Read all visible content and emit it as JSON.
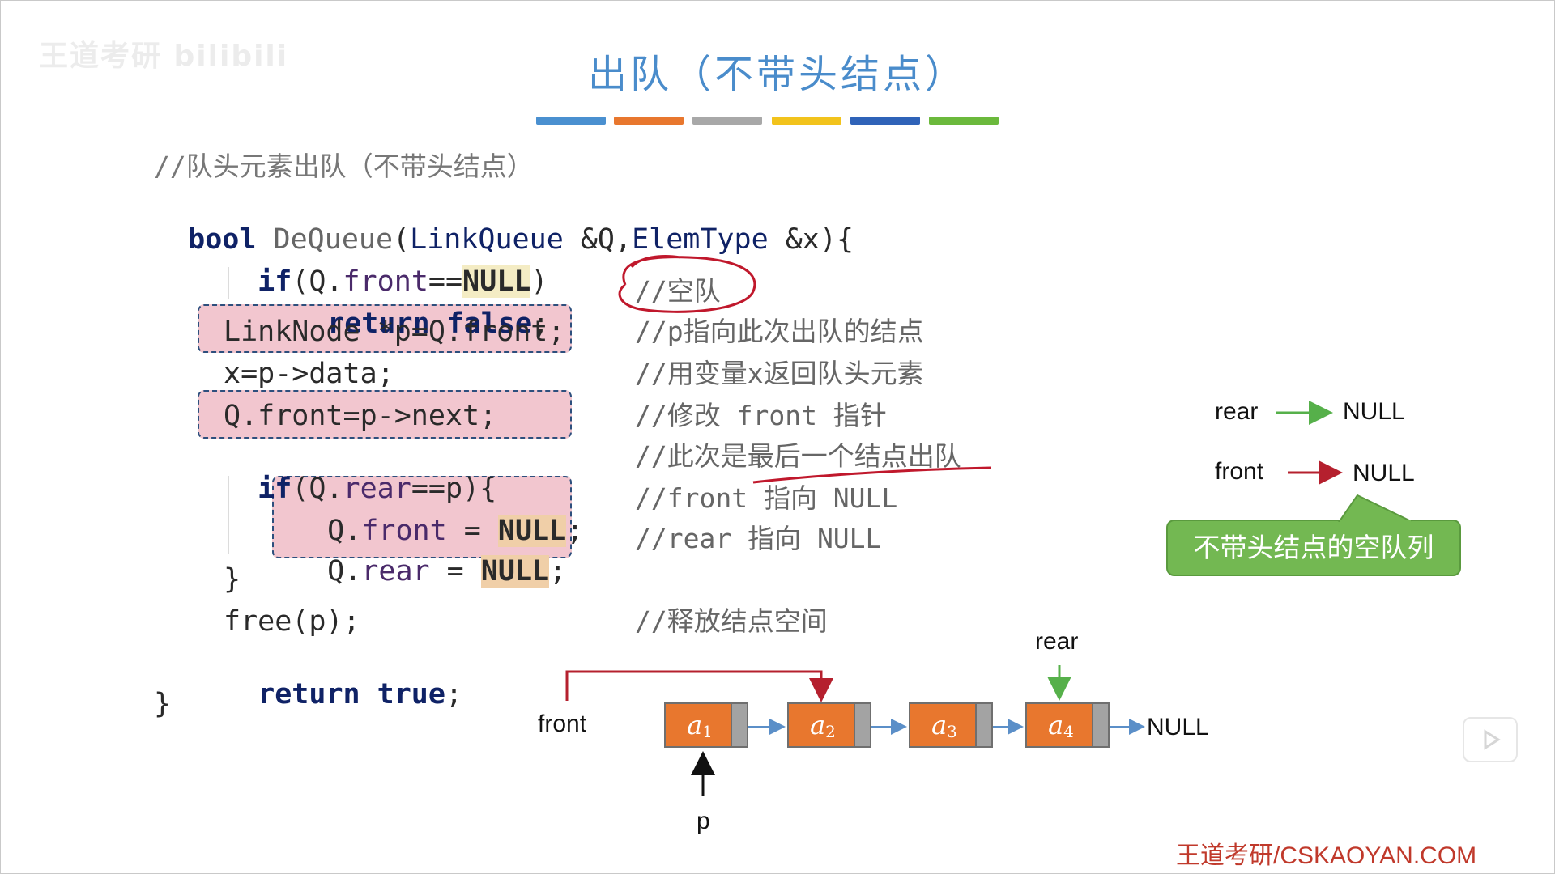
{
  "slide": {
    "watermark": "王道考研 bilibili",
    "title": "出队（不带头结点）",
    "color_bar": [
      "#4a90d0",
      "#e8772e",
      "#a8a8a8",
      "#f2c31c",
      "#2f63b8",
      "#6bb93c"
    ],
    "footer": "王道考研/CSKAOYAN.COM"
  },
  "code": {
    "header_comment": "//队头元素出队（不带头结点）",
    "l1": {
      "kw": "bool",
      "fn": "DeQueue",
      "p1": "(",
      "t1": "LinkQueue",
      "p2": " &Q,",
      "t2": "ElemType",
      "p3": " &x){"
    },
    "l2": {
      "kw": "if",
      "a": "(Q.",
      "m": "front",
      "b": "==",
      "n": "NULL",
      "c": ")"
    },
    "l3": {
      "kw": "return false",
      "c": ";"
    },
    "l4": "LinkNode *p=Q.front;",
    "l5": "x=p->data;",
    "l6": "Q.front=p->next;",
    "l7": {
      "kw": "if",
      "a": "(Q.",
      "m": "rear",
      "b": "==p){"
    },
    "l8": {
      "a": "Q.",
      "m": "front",
      "b": " = ",
      "n": "NULL",
      "c": ";"
    },
    "l9": {
      "a": "Q.",
      "m": "rear",
      "b": " = ",
      "n": "NULL",
      "c": ";"
    },
    "l10": "}",
    "l11": "free(p);",
    "l12": {
      "kw": "return true",
      "c": ";"
    },
    "l13": "}"
  },
  "comments": {
    "c3": "//空队",
    "c4": "//p指向此次出队的结点",
    "c5": "//用变量x返回队头元素",
    "c6": "//修改 front 指针",
    "c7": "//此次是最后一个结点出队",
    "c8": "//front 指向 NULL",
    "c9": "//rear 指向 NULL",
    "c11": "//释放结点空间"
  },
  "empty_queue": {
    "rear_label": "rear",
    "rear_null": "NULL",
    "front_label": "front",
    "front_null": "NULL",
    "callout": "不带头结点的空队列",
    "rear_arrow_color": "#56b04a",
    "front_arrow_color": "#b5202e"
  },
  "linked_list": {
    "front_label": "front",
    "rear_label": "rear",
    "p_label": "p",
    "null_label": "NULL",
    "nodes": [
      {
        "sym": "a",
        "sub": "1"
      },
      {
        "sym": "a",
        "sub": "2"
      },
      {
        "sym": "a",
        "sub": "3"
      },
      {
        "sym": "a",
        "sub": "4"
      }
    ],
    "node_color": "#e8772e",
    "front_arrow_color": "#b5202e",
    "rear_arrow_color": "#56b04a"
  }
}
